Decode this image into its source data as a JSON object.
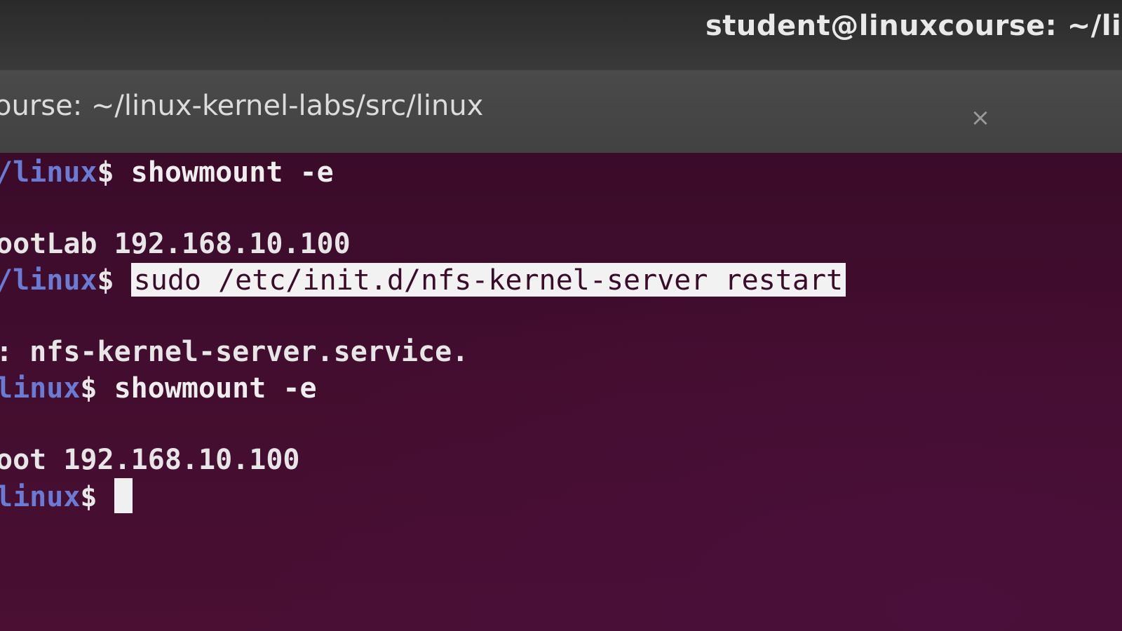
{
  "window": {
    "title": "student@linuxcourse: ~/linux"
  },
  "tab": {
    "title": "ourse: ~/linux-kernel-labs/src/linux",
    "close_glyph": "×"
  },
  "terminal": {
    "prompt_suffix": "linux",
    "prompt_dollar": "$ ",
    "lines": [
      {
        "prompt": "/linux",
        "command": "showmount -e"
      },
      {
        "output": "ootLab 192.168.10.100"
      },
      {
        "prompt": "/linux",
        "command": "sudo /etc/init.d/nfs-kernel-server restart"
      },
      {
        "output": ": nfs-kernel-server.service."
      },
      {
        "prompt": "linux",
        "command": "showmount -e"
      },
      {
        "output": "oot 192.168.10.100"
      },
      {
        "prompt": "linux",
        "command": ""
      }
    ]
  },
  "colors": {
    "terminal_bg": "#3b0b2a",
    "prompt": "#6a7bd6",
    "accent": "#e95420"
  }
}
